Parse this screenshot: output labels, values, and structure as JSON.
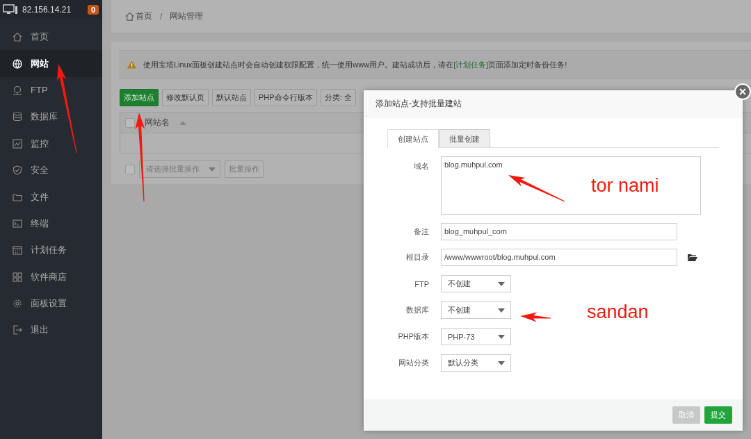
{
  "server": {
    "ip": "82.156.14.21",
    "badge": "0"
  },
  "sidebar": {
    "items": [
      {
        "label": "首页",
        "selected": false
      },
      {
        "label": "网站",
        "selected": true
      },
      {
        "label": "FTP",
        "selected": false
      },
      {
        "label": "数据库",
        "selected": false
      },
      {
        "label": "监控",
        "selected": false
      },
      {
        "label": "安全",
        "selected": false
      },
      {
        "label": "文件",
        "selected": false
      },
      {
        "label": "终端",
        "selected": false
      },
      {
        "label": "计划任务",
        "selected": false
      },
      {
        "label": "软件商店",
        "selected": false
      },
      {
        "label": "面板设置",
        "selected": false
      },
      {
        "label": "退出",
        "selected": false
      }
    ]
  },
  "breadcrumb": {
    "items": [
      "首页",
      "网站管理"
    ],
    "separator": "/"
  },
  "notice": {
    "text": "使用宝塔Linux面板创建站点时会自动创建权限配置，统一使用www用户。建站成功后，请在",
    "link": "[计划任务]",
    "after": "页面添加定时备份任务!"
  },
  "toolbar": [
    {
      "label": "添加站点",
      "kind": "primary"
    },
    {
      "label": "修改默认页",
      "kind": "default"
    },
    {
      "label": "默认站点",
      "kind": "default"
    },
    {
      "label": "PHP命令行版本",
      "kind": "default"
    },
    {
      "label": "分类: 全",
      "kind": "default"
    }
  ],
  "table": {
    "select_all_checked": false,
    "columns": [
      {
        "label": "网站名"
      }
    ]
  },
  "batch": {
    "checked": false,
    "placeholder": "请选择批量操作",
    "button": "批量操作"
  },
  "modal": {
    "title": "添加站点-支持批量建站",
    "tabs": [
      {
        "label": "创建站点",
        "selected": true
      },
      {
        "label": "批量创建",
        "selected": false
      }
    ],
    "fields": [
      {
        "label": "域名",
        "kind": "textarea",
        "value": "blog.muhpul.com"
      },
      {
        "label": "备注",
        "kind": "input",
        "value": "blog_muhpul_com"
      },
      {
        "label": "根目录",
        "kind": "folder",
        "value": "/www/wwwroot/blog.muhpul.com"
      },
      {
        "label": "FTP",
        "kind": "select",
        "value": "不创建"
      },
      {
        "label": "数据库",
        "kind": "select",
        "value": "不创建"
      },
      {
        "label": "PHP版本",
        "kind": "select",
        "value": "PHP-73"
      },
      {
        "label": "网站分类",
        "kind": "select",
        "value": "默认分类"
      }
    ],
    "buttons": [
      {
        "label": "取消",
        "kind": "cancel"
      },
      {
        "label": "提交",
        "kind": "submit"
      }
    ]
  },
  "annotations": [
    {
      "text": "tor nami"
    },
    {
      "text": "sandan"
    }
  ]
}
